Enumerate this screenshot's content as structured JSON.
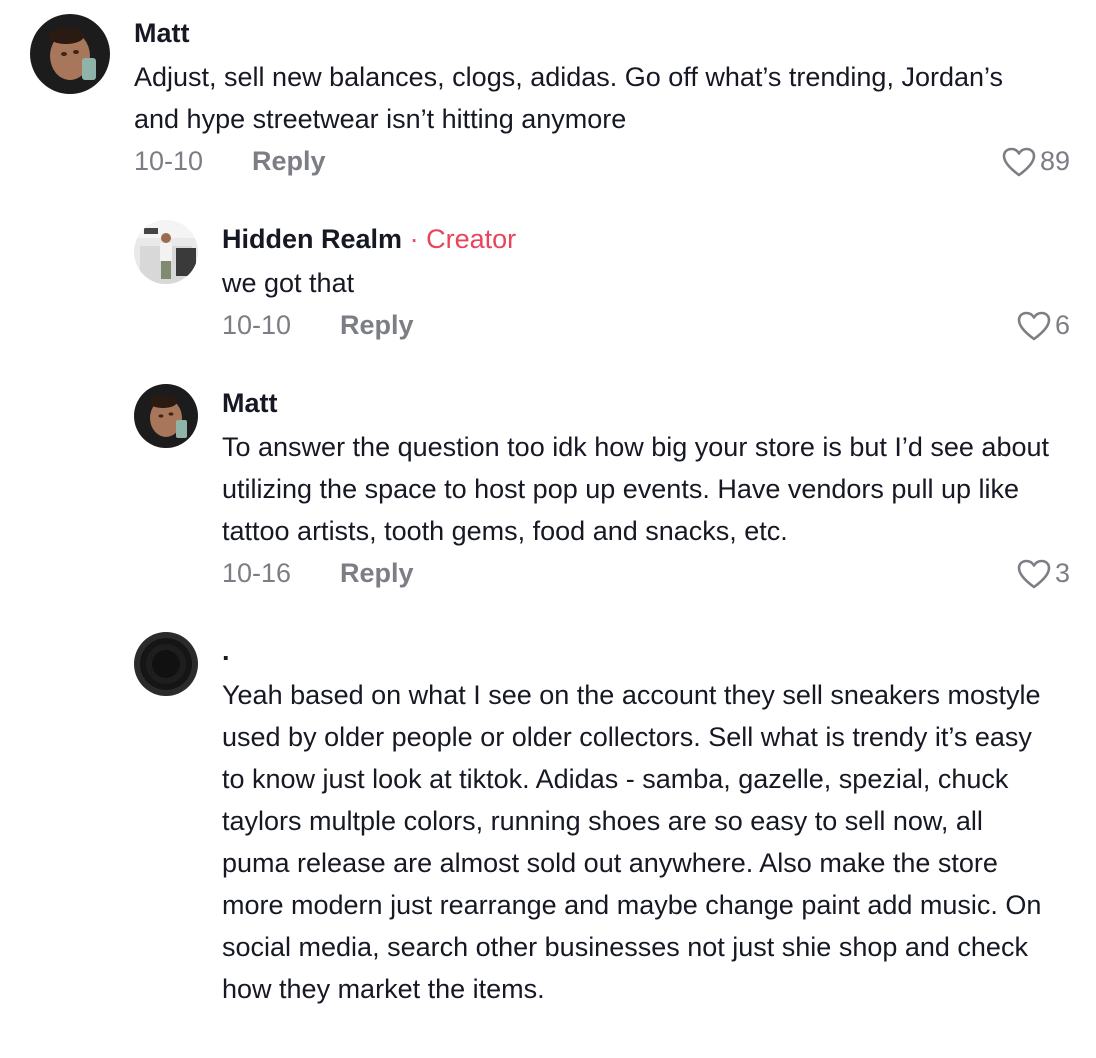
{
  "comments": [
    {
      "username": "Matt",
      "text": "Adjust, sell new balances, clogs, adidas. Go off what’s trending, Jordan’s and hype streetwear isn’t hitting anymore",
      "date": "10-10",
      "reply_label": "Reply",
      "likes": "89"
    },
    {
      "username": "Hidden Realm",
      "separator": "·",
      "badge": "Creator",
      "text": "we got that",
      "date": "10-10",
      "reply_label": "Reply",
      "likes": "6"
    },
    {
      "username": "Matt",
      "text": "To answer the question too idk how big your store is but I’d see about utilizing the space to host pop up events. Have vendors pull up like tattoo artists, tooth gems, food and snacks, etc.",
      "date": "10-16",
      "reply_label": "Reply",
      "likes": "3"
    },
    {
      "username": ".",
      "text": "Yeah based on what I see on the account they sell sneakers mostyle used by older people or older collectors. Sell what is trendy it’s easy to know just look at tiktok. Adidas - samba, gazelle, spezial, chuck taylors multple colors, running shoes are so easy to sell now, all puma release are almost sold out anywhere. Also make the store more modern just rearrange and maybe change paint add music. On social media, search other businesses not just shie shop and check how they market the items."
    }
  ],
  "colors": {
    "creator": "#e8455a",
    "meta": "#7d7e85",
    "text": "#161823"
  },
  "icons": {
    "like": "heart-outline-icon"
  }
}
